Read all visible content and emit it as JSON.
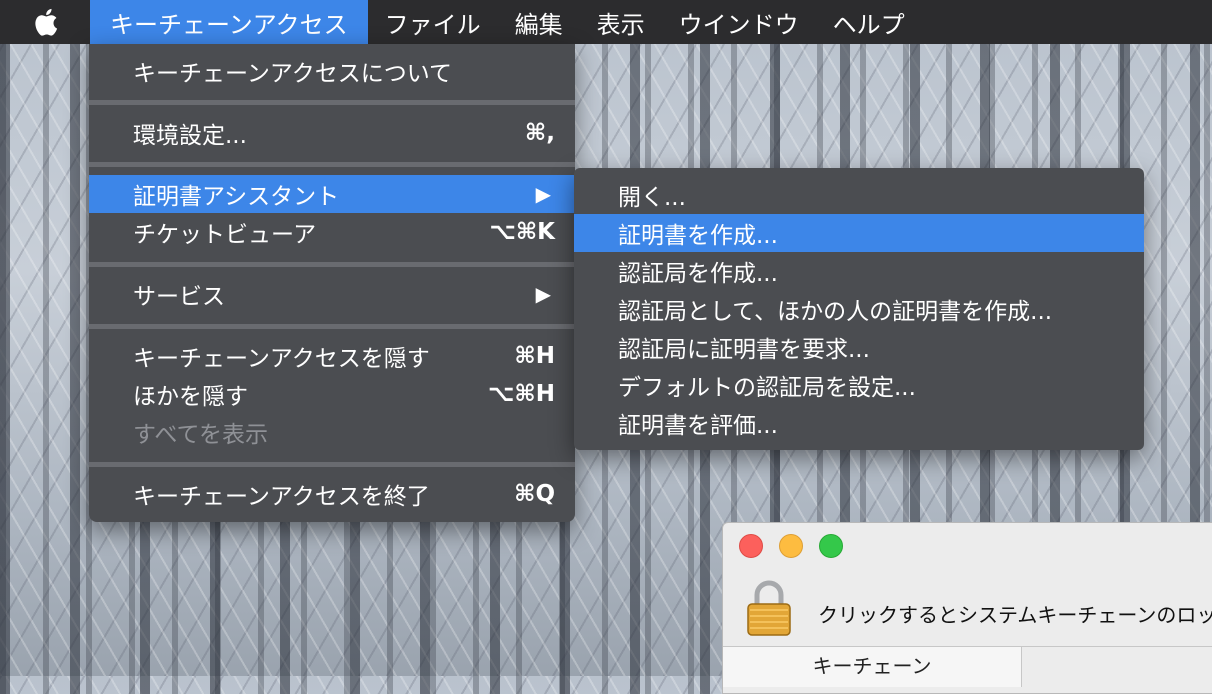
{
  "menubar": {
    "apple_icon": "apple-logo",
    "items": [
      {
        "label": "キーチェーンアクセス",
        "active": true
      },
      {
        "label": "ファイル"
      },
      {
        "label": "編集"
      },
      {
        "label": "表示"
      },
      {
        "label": "ウインドウ"
      },
      {
        "label": "ヘルプ"
      }
    ]
  },
  "app_menu": {
    "about": "キーチェーンアクセスについて",
    "preferences": {
      "label": "環境設定...",
      "shortcut": "⌘,"
    },
    "certificate_assistant": {
      "label": "証明書アシスタント",
      "submenu_arrow": "▶"
    },
    "ticket_viewer": {
      "label": "チケットビューア",
      "shortcut": "⌥⌘K"
    },
    "services": {
      "label": "サービス",
      "submenu_arrow": "▶"
    },
    "hide_app": {
      "label": "キーチェーンアクセスを隠す",
      "shortcut": "⌘H"
    },
    "hide_others": {
      "label": "ほかを隠す",
      "shortcut": "⌥⌘H"
    },
    "show_all": {
      "label": "すべてを表示"
    },
    "quit": {
      "label": "キーチェーンアクセスを終了",
      "shortcut": "⌘Q"
    }
  },
  "cert_submenu": {
    "items": [
      {
        "label": "開く..."
      },
      {
        "label": "証明書を作成..."
      },
      {
        "label": "認証局を作成..."
      },
      {
        "label": "認証局として、ほかの人の証明書を作成..."
      },
      {
        "label": "認証局に証明書を要求..."
      },
      {
        "label": "デフォルトの認証局を設定..."
      },
      {
        "label": "証明書を評価..."
      }
    ],
    "highlighted_index": 1
  },
  "window": {
    "lock_text": "クリックするとシステムキーチェーンのロッ",
    "column_header": "キーチェーン"
  },
  "colors": {
    "menu_bg": "#4b4d51",
    "highlight": "#3d86e8",
    "menubar_bg": "#2c2c2e"
  }
}
